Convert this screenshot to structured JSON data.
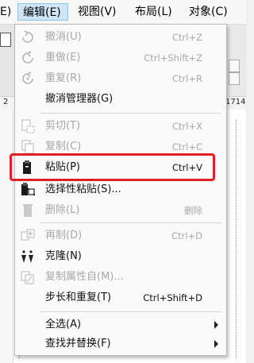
{
  "menubar": {
    "items": [
      {
        "label": "E)"
      },
      {
        "label": "编辑(E)"
      },
      {
        "label": "视图(V)"
      },
      {
        "label": "布局(L)"
      },
      {
        "label": "对象(C)"
      }
    ]
  },
  "background": {
    "ruler_label_left": "2",
    "ruler_label_right": "1714"
  },
  "edit_menu": {
    "items": [
      {
        "label": "撤消(U)",
        "shortcut": "Ctrl+Z"
      },
      {
        "label": "重做(E)",
        "shortcut": "Ctrl+Shift+Z"
      },
      {
        "label": "重复(R)",
        "shortcut": "Ctrl+R"
      },
      {
        "label": "撤消管理器(G)",
        "shortcut": ""
      },
      {
        "label": "剪切(T)",
        "shortcut": "Ctrl+X"
      },
      {
        "label": "复制(C)",
        "shortcut": "Ctrl+C"
      },
      {
        "label": "粘贴(P)",
        "shortcut": "Ctrl+V"
      },
      {
        "label": "选择性粘贴(S)...",
        "shortcut": ""
      },
      {
        "label": "删除(L)",
        "shortcut": "删除"
      },
      {
        "label": "再制(D)",
        "shortcut": "Ctrl+D"
      },
      {
        "label": "克隆(N)",
        "shortcut": ""
      },
      {
        "label": "复制属性自(M)...",
        "shortcut": ""
      },
      {
        "label": "步长和重复(T)",
        "shortcut": "Ctrl+Shift+D"
      },
      {
        "label": "全选(A)",
        "shortcut": ""
      },
      {
        "label": "查找并替换(F)",
        "shortcut": ""
      }
    ]
  },
  "colors": {
    "highlight_box": "#e02020",
    "disabled_text": "#a8a8a8",
    "active_menu_bg": "#cfe6f8"
  }
}
